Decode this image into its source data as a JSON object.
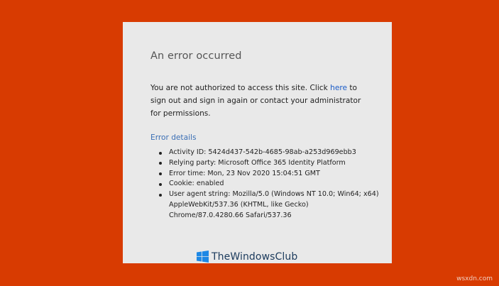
{
  "page": {
    "title": "An error occurred",
    "message_before": "You are not authorized to access this site. Click ",
    "message_link": "here",
    "message_after": " to sign out and sign in again or contact your administrator for permissions."
  },
  "details": {
    "link_label": "Error details",
    "items": [
      "Activity ID: 5424d437-542b-4685-98ab-a253d969ebb3",
      "Relying party: Microsoft Office 365 Identity Platform",
      "Error time: Mon, 23 Nov 2020 15:04:51 GMT",
      "Cookie: enabled",
      "User agent string: Mozilla/5.0 (Windows NT 10.0; Win64; x64) AppleWebKit/537.36 (KHTML, like Gecko) Chrome/87.0.4280.66 Safari/537.36"
    ]
  },
  "watermark": {
    "text": "TheWindowsClub",
    "icon": "windows-logo-icon",
    "color": "#1b3a5c"
  },
  "corner_watermark": "wsxdn.com",
  "colors": {
    "background": "#d83b01",
    "card": "#e9e9e9",
    "link": "#1a5cc8"
  }
}
